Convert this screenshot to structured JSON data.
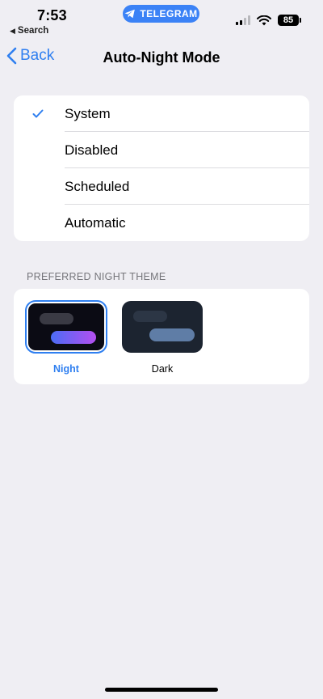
{
  "status_bar": {
    "time": "7:53",
    "back_app": "Search",
    "pill_label": "TELEGRAM",
    "battery": "85"
  },
  "nav": {
    "back_label": "Back",
    "title": "Auto-Night Mode"
  },
  "options": {
    "items": [
      {
        "label": "System",
        "selected": true
      },
      {
        "label": "Disabled",
        "selected": false
      },
      {
        "label": "Scheduled",
        "selected": false
      },
      {
        "label": "Automatic",
        "selected": false
      }
    ]
  },
  "themes": {
    "header": "PREFERRED NIGHT THEME",
    "items": [
      {
        "label": "Night",
        "selected": true
      },
      {
        "label": "Dark",
        "selected": false
      }
    ]
  },
  "colors": {
    "accent": "#2f7ff0",
    "background": "#efeef3",
    "pill": "#3b82f6"
  }
}
